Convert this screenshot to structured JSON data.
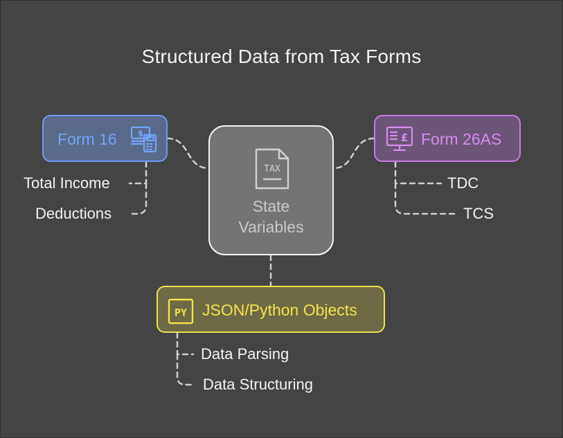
{
  "title": "Structured Data from Tax Forms",
  "center": {
    "line1": "State",
    "line2": "Variables",
    "icon": "tax-document-icon",
    "icon_text": "TAX"
  },
  "form16": {
    "label": "Form 16",
    "icon": "money-calculator-icon",
    "items": [
      "Total Income",
      "Deductions"
    ]
  },
  "form26as": {
    "label": "Form 26AS",
    "icon": "monitor-pound-icon",
    "items": [
      "TDC",
      "TCS"
    ]
  },
  "json": {
    "label": "JSON/Python Objects",
    "icon": "python-file-icon",
    "icon_text": "PY",
    "items": [
      "Data Parsing",
      "Data Structuring"
    ]
  },
  "colors": {
    "background": "#444444",
    "form16_accent": "#6d9cf5",
    "form26as_accent": "#cc7ae8",
    "json_accent": "#efe14f",
    "center_border": "#f4f4f4"
  }
}
